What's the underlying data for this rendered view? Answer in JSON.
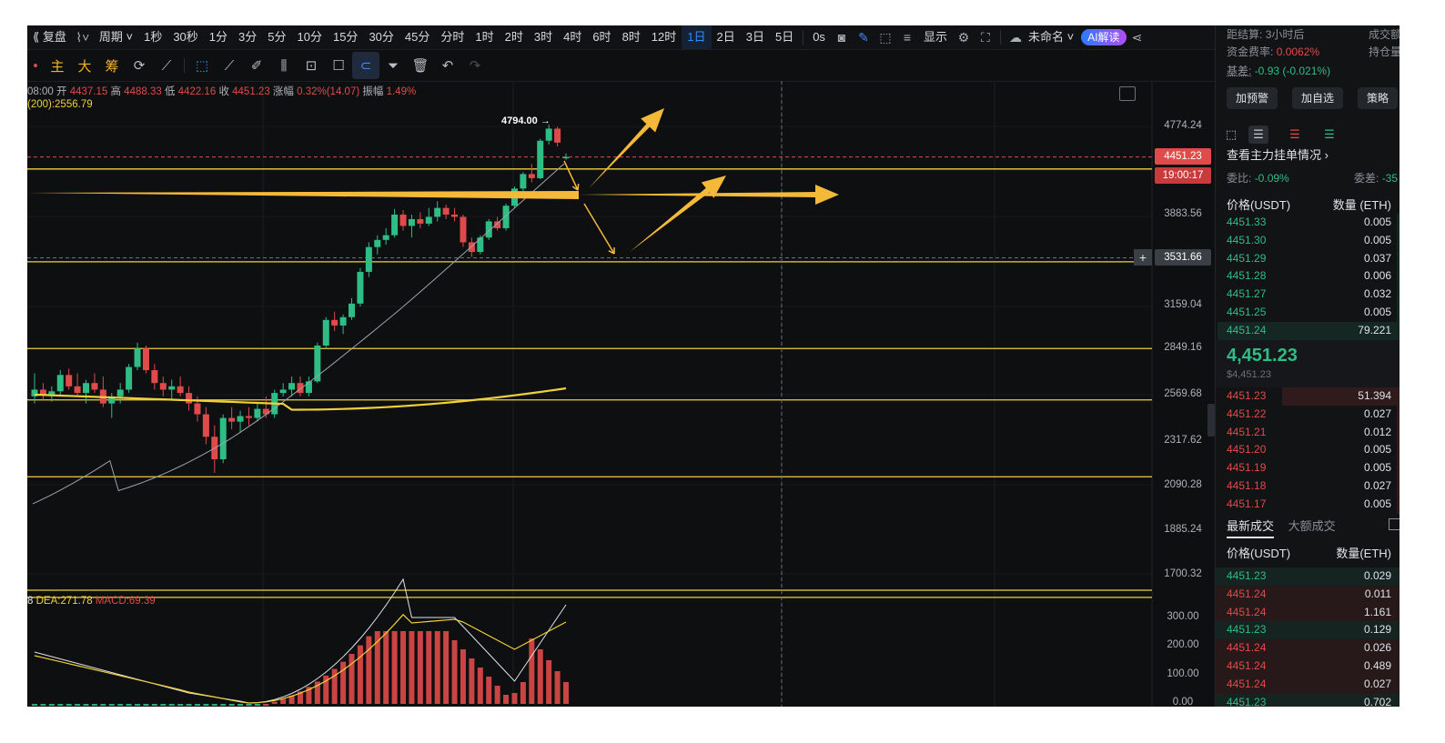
{
  "toolbar": {
    "replay": "复盘",
    "period": "周期",
    "timeframes": [
      "1秒",
      "30秒",
      "1分",
      "3分",
      "5分",
      "10分",
      "15分",
      "30分",
      "45分",
      "分时",
      "1时",
      "2时",
      "3时",
      "4时",
      "6时",
      "8时",
      "12时",
      "1日",
      "2日",
      "3日",
      "5日"
    ],
    "active_timeframe": "1日",
    "latency": "0s",
    "display": "显示",
    "layout_name": "未命名",
    "ai": "AI解读"
  },
  "drawbar": {
    "main": "主",
    "big": "大",
    "chips": "筹"
  },
  "ohlc": {
    "time": "08:00",
    "open_label": "开",
    "open": "4437.15",
    "high_label": "高",
    "high": "4488.33",
    "low_label": "低",
    "low": "4422.16",
    "close_label": "收",
    "close": "4451.23",
    "change_label": "涨幅",
    "change": "0.32%(14.07)",
    "amp_label": "振幅",
    "amp": "1.49%"
  },
  "ma200": "(200):2556.79",
  "macd": {
    "dif_tail": "8",
    "dea": "DEA:271.78",
    "macd": "MACD:69.39"
  },
  "high_marker": "4794.00",
  "price_axis": [
    "4774.24",
    "3883.56",
    "3159.04",
    "2849.16",
    "2569.68",
    "2317.62",
    "2090.28",
    "1885.24",
    "1700.32"
  ],
  "macd_axis": [
    "300.00",
    "200.00",
    "100.00",
    "0.00"
  ],
  "current_price_tag": "4451.23",
  "countdown_tag": "19:00:17",
  "crosshair_tag": "3531.66",
  "chart_data": {
    "type": "candlestick",
    "instrument_unit": "USDT",
    "candles": [
      {
        "o": 2560,
        "h": 2700,
        "l": 2520,
        "c": 2600
      },
      {
        "o": 2600,
        "h": 2640,
        "l": 2540,
        "c": 2570
      },
      {
        "o": 2570,
        "h": 2620,
        "l": 2530,
        "c": 2590
      },
      {
        "o": 2590,
        "h": 2720,
        "l": 2560,
        "c": 2690
      },
      {
        "o": 2690,
        "h": 2730,
        "l": 2600,
        "c": 2620
      },
      {
        "o": 2620,
        "h": 2700,
        "l": 2560,
        "c": 2580
      },
      {
        "o": 2580,
        "h": 2660,
        "l": 2520,
        "c": 2640
      },
      {
        "o": 2640,
        "h": 2700,
        "l": 2580,
        "c": 2600
      },
      {
        "o": 2600,
        "h": 2680,
        "l": 2500,
        "c": 2520
      },
      {
        "o": 2520,
        "h": 2580,
        "l": 2440,
        "c": 2560
      },
      {
        "o": 2560,
        "h": 2640,
        "l": 2520,
        "c": 2600
      },
      {
        "o": 2600,
        "h": 2760,
        "l": 2580,
        "c": 2740
      },
      {
        "o": 2740,
        "h": 2900,
        "l": 2720,
        "c": 2860
      },
      {
        "o": 2860,
        "h": 2880,
        "l": 2700,
        "c": 2720
      },
      {
        "o": 2720,
        "h": 2760,
        "l": 2600,
        "c": 2640
      },
      {
        "o": 2640,
        "h": 2680,
        "l": 2560,
        "c": 2600
      },
      {
        "o": 2600,
        "h": 2660,
        "l": 2540,
        "c": 2620
      },
      {
        "o": 2620,
        "h": 2680,
        "l": 2560,
        "c": 2580
      },
      {
        "o": 2580,
        "h": 2620,
        "l": 2480,
        "c": 2520
      },
      {
        "o": 2520,
        "h": 2560,
        "l": 2420,
        "c": 2460
      },
      {
        "o": 2460,
        "h": 2500,
        "l": 2300,
        "c": 2340
      },
      {
        "o": 2340,
        "h": 2400,
        "l": 2150,
        "c": 2220
      },
      {
        "o": 2220,
        "h": 2460,
        "l": 2200,
        "c": 2440
      },
      {
        "o": 2440,
        "h": 2500,
        "l": 2380,
        "c": 2420
      },
      {
        "o": 2420,
        "h": 2480,
        "l": 2360,
        "c": 2450
      },
      {
        "o": 2450,
        "h": 2500,
        "l": 2400,
        "c": 2440
      },
      {
        "o": 2440,
        "h": 2520,
        "l": 2420,
        "c": 2490
      },
      {
        "o": 2490,
        "h": 2560,
        "l": 2440,
        "c": 2460
      },
      {
        "o": 2460,
        "h": 2600,
        "l": 2440,
        "c": 2580
      },
      {
        "o": 2580,
        "h": 2640,
        "l": 2560,
        "c": 2600
      },
      {
        "o": 2600,
        "h": 2680,
        "l": 2560,
        "c": 2640
      },
      {
        "o": 2640,
        "h": 2680,
        "l": 2560,
        "c": 2580
      },
      {
        "o": 2580,
        "h": 2680,
        "l": 2560,
        "c": 2650
      },
      {
        "o": 2650,
        "h": 2900,
        "l": 2640,
        "c": 2880
      },
      {
        "o": 2880,
        "h": 3080,
        "l": 2860,
        "c": 3060
      },
      {
        "o": 3060,
        "h": 3120,
        "l": 2980,
        "c": 3020
      },
      {
        "o": 3020,
        "h": 3100,
        "l": 2960,
        "c": 3080
      },
      {
        "o": 3080,
        "h": 3220,
        "l": 3060,
        "c": 3180
      },
      {
        "o": 3180,
        "h": 3450,
        "l": 3160,
        "c": 3420
      },
      {
        "o": 3420,
        "h": 3660,
        "l": 3380,
        "c": 3620
      },
      {
        "o": 3620,
        "h": 3720,
        "l": 3560,
        "c": 3680
      },
      {
        "o": 3680,
        "h": 3780,
        "l": 3640,
        "c": 3720
      },
      {
        "o": 3720,
        "h": 3950,
        "l": 3700,
        "c": 3900
      },
      {
        "o": 3900,
        "h": 3940,
        "l": 3760,
        "c": 3800
      },
      {
        "o": 3800,
        "h": 3900,
        "l": 3700,
        "c": 3860
      },
      {
        "o": 3860,
        "h": 3920,
        "l": 3780,
        "c": 3820
      },
      {
        "o": 3820,
        "h": 3960,
        "l": 3800,
        "c": 3880
      },
      {
        "o": 3880,
        "h": 4020,
        "l": 3840,
        "c": 3960
      },
      {
        "o": 3960,
        "h": 3990,
        "l": 3860,
        "c": 3900
      },
      {
        "o": 3900,
        "h": 3960,
        "l": 3840,
        "c": 3880
      },
      {
        "o": 3880,
        "h": 3900,
        "l": 3620,
        "c": 3660
      },
      {
        "o": 3660,
        "h": 3700,
        "l": 3540,
        "c": 3580
      },
      {
        "o": 3580,
        "h": 3720,
        "l": 3560,
        "c": 3700
      },
      {
        "o": 3700,
        "h": 3860,
        "l": 3680,
        "c": 3840
      },
      {
        "o": 3840,
        "h": 3880,
        "l": 3760,
        "c": 3780
      },
      {
        "o": 3780,
        "h": 4000,
        "l": 3760,
        "c": 3980
      },
      {
        "o": 3980,
        "h": 4160,
        "l": 3960,
        "c": 4140
      },
      {
        "o": 4140,
        "h": 4300,
        "l": 4100,
        "c": 4280
      },
      {
        "o": 4280,
        "h": 4380,
        "l": 4200,
        "c": 4240
      },
      {
        "o": 4240,
        "h": 4640,
        "l": 4230,
        "c": 4620
      },
      {
        "o": 4620,
        "h": 4794,
        "l": 4580,
        "c": 4750
      },
      {
        "o": 4750,
        "h": 4770,
        "l": 4560,
        "c": 4600
      },
      {
        "o": 4437.15,
        "h": 4488.33,
        "l": 4422.16,
        "c": 4451.23
      }
    ],
    "ma200": 2556.79,
    "horizontal_levels": [
      4330,
      3500,
      2860,
      2540,
      2130,
      1610
    ],
    "macd": {
      "dea": 271.78,
      "macd": 69.39
    }
  },
  "panel": {
    "settle_label": "距结算:",
    "settle_value": "3小时后",
    "volume_label": "成交额",
    "funding_label": "资金费率:",
    "funding_value": "0.0062%",
    "oi_label": "持仓量",
    "basis_label": "基差:",
    "basis_value": "-0.93 (-0.021%)",
    "btn_alert": "加预警",
    "btn_watch": "加自选",
    "btn_strategy": "策略",
    "depth_link": "查看主力挂单情况",
    "ratio_label": "委比:",
    "ratio_value": "-0.09%",
    "diff_label": "委差:",
    "diff_value": "-35",
    "col_price": "价格(USDT)",
    "col_qty": "数量 (ETH)",
    "asks": [
      {
        "p": "4451.33",
        "q": "0.005"
      },
      {
        "p": "4451.30",
        "q": "0.005"
      },
      {
        "p": "4451.29",
        "q": "0.037"
      },
      {
        "p": "4451.28",
        "q": "0.006"
      },
      {
        "p": "4451.27",
        "q": "0.032"
      },
      {
        "p": "4451.25",
        "q": "0.005"
      },
      {
        "p": "4451.24",
        "q": "79.221"
      }
    ],
    "last_price": "4,451.23",
    "last_price_usd": "$4,451.23",
    "bids": [
      {
        "p": "4451.23",
        "q": "51.394"
      },
      {
        "p": "4451.22",
        "q": "0.027"
      },
      {
        "p": "4451.21",
        "q": "0.012"
      },
      {
        "p": "4451.20",
        "q": "0.005"
      },
      {
        "p": "4451.19",
        "q": "0.005"
      },
      {
        "p": "4451.18",
        "q": "0.027"
      },
      {
        "p": "4451.17",
        "q": "0.005"
      }
    ],
    "tab_trades": "最新成交",
    "tab_large": "大额成交",
    "trades_col_price": "价格(USDT)",
    "trades_col_qty": "数量(ETH)",
    "trades": [
      {
        "p": "4451.23",
        "q": "0.029",
        "side": "buy"
      },
      {
        "p": "4451.24",
        "q": "0.011",
        "side": "sell"
      },
      {
        "p": "4451.24",
        "q": "1.161",
        "side": "sell"
      },
      {
        "p": "4451.23",
        "q": "0.129",
        "side": "buy"
      },
      {
        "p": "4451.24",
        "q": "0.026",
        "side": "sell"
      },
      {
        "p": "4451.24",
        "q": "0.489",
        "side": "sell"
      },
      {
        "p": "4451.24",
        "q": "0.027",
        "side": "sell"
      },
      {
        "p": "4451.23",
        "q": "0.702",
        "side": "buy"
      }
    ]
  },
  "colors": {
    "up": "#2ebd85",
    "down": "#e04a4a",
    "level": "#f0d03a",
    "arrow": "#f5b93a",
    "accent": "#2f8cff"
  }
}
